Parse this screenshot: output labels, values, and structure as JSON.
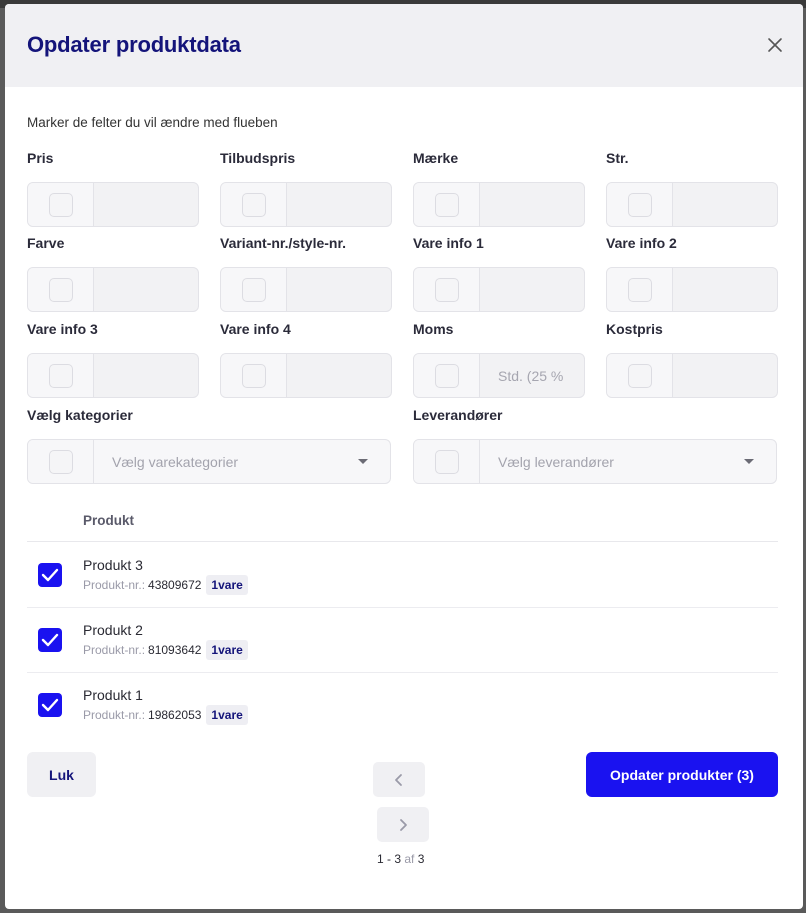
{
  "modal": {
    "title": "Opdater produktdata",
    "instruction": "Marker de felter du vil ændre med flueben"
  },
  "fields": [
    {
      "label": "Pris",
      "value": ""
    },
    {
      "label": "Tilbudspris",
      "value": ""
    },
    {
      "label": "Mærke",
      "value": ""
    },
    {
      "label": "Str.",
      "value": ""
    },
    {
      "label": "Farve",
      "value": ""
    },
    {
      "label": "Variant-nr./style-nr.",
      "value": ""
    },
    {
      "label": "Vare info 1",
      "value": ""
    },
    {
      "label": "Vare info 2",
      "value": ""
    },
    {
      "label": "Vare info 3",
      "value": ""
    },
    {
      "label": "Vare info 4",
      "value": ""
    },
    {
      "label": "Moms",
      "value": "Std. (25 %"
    },
    {
      "label": "Kostpris",
      "value": ""
    }
  ],
  "selects": [
    {
      "label": "Vælg kategorier",
      "placeholder": "Vælg varekategorier"
    },
    {
      "label": "Leverandører",
      "placeholder": "Vælg leverandører"
    }
  ],
  "table": {
    "header": "Produkt",
    "meta_label": "Produkt-nr.:",
    "rows": [
      {
        "name": "Produkt 3",
        "number": "43809672",
        "badge": "1vare",
        "checked": true
      },
      {
        "name": "Produkt 2",
        "number": "81093642",
        "badge": "1vare",
        "checked": true
      },
      {
        "name": "Produkt 1",
        "number": "19862053",
        "badge": "1vare",
        "checked": true
      }
    ]
  },
  "footer": {
    "close_label": "Luk",
    "update_label": "Opdater produkter (3)"
  },
  "pagination": {
    "range": "1 - 3",
    "of": "af",
    "total": "3"
  },
  "colors": {
    "accent": "#1a12f0",
    "title": "#14147a"
  },
  "icons": {
    "close": "close-icon",
    "prev": "chevron-left-icon",
    "next": "chevron-right-icon",
    "caret": "caret-down-icon",
    "check": "checkmark-icon"
  }
}
